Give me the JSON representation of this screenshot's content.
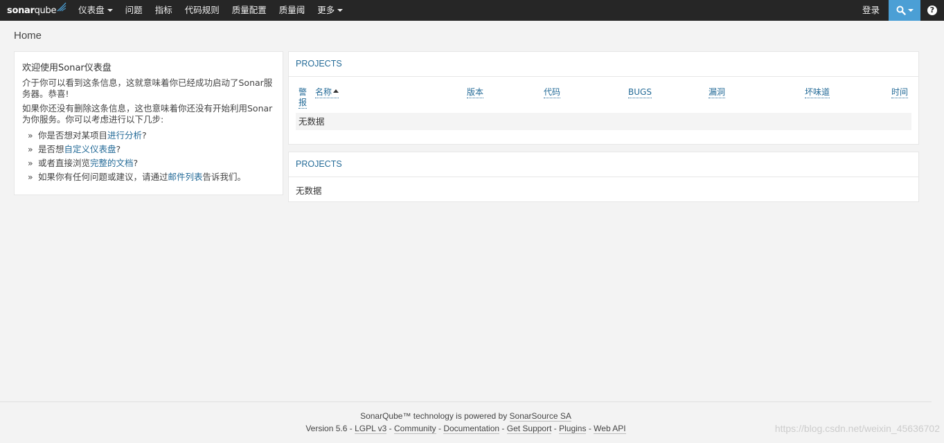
{
  "brand": {
    "logo_bold": "sonar",
    "logo_light": "qube"
  },
  "nav": {
    "items": [
      {
        "label": "仪表盘",
        "dropdown": true
      },
      {
        "label": "问题",
        "dropdown": false
      },
      {
        "label": "指标",
        "dropdown": false
      },
      {
        "label": "代码规则",
        "dropdown": false
      },
      {
        "label": "质量配置",
        "dropdown": false
      },
      {
        "label": "质量阈",
        "dropdown": false
      },
      {
        "label": "更多",
        "dropdown": true
      }
    ],
    "login": "登录",
    "help_glyph": "?"
  },
  "page": {
    "title": "Home"
  },
  "welcome": {
    "heading": "欢迎使用Sonar仪表盘",
    "para1": "介于你可以看到这条信息，这就意味着你已经成功启动了Sonar服务器。恭喜!",
    "para2": "如果你还没有删除这条信息，这也意味着你还没有开始利用Sonar为你服务。你可以考虑进行以下几步:",
    "bullet": "»",
    "items": [
      {
        "pre": "你是否想对某项目",
        "link": "进行分析",
        "post": "?"
      },
      {
        "pre": "是否想",
        "link": "自定义仪表盘",
        "post": "?"
      },
      {
        "pre": "或者直接浏览",
        "link": "完整的文档",
        "post": "?"
      },
      {
        "pre": "如果你有任何问题或建议，请通过",
        "link": "邮件列表",
        "post": "告诉我们。"
      }
    ]
  },
  "projects_table": {
    "title": "PROJECTS",
    "columns": {
      "alert": "警报",
      "name": "名称",
      "version": "版本",
      "code": "代码",
      "bugs": "BUGS",
      "vulnerabilities": "漏洞",
      "code_smells": "坏味道",
      "time": "时间"
    },
    "empty": "无数据"
  },
  "projects_second": {
    "title": "PROJECTS",
    "empty": "无数据"
  },
  "footer": {
    "line1_pre": "SonarQube™ technology is powered by ",
    "line1_link": "SonarSource SA",
    "version": "Version 5.6",
    "links": [
      "LGPL v3",
      "Community",
      "Documentation",
      "Get Support",
      "Plugins",
      "Web API"
    ],
    "sep": " - "
  },
  "watermark": "https://blog.csdn.net/weixin_45636702"
}
